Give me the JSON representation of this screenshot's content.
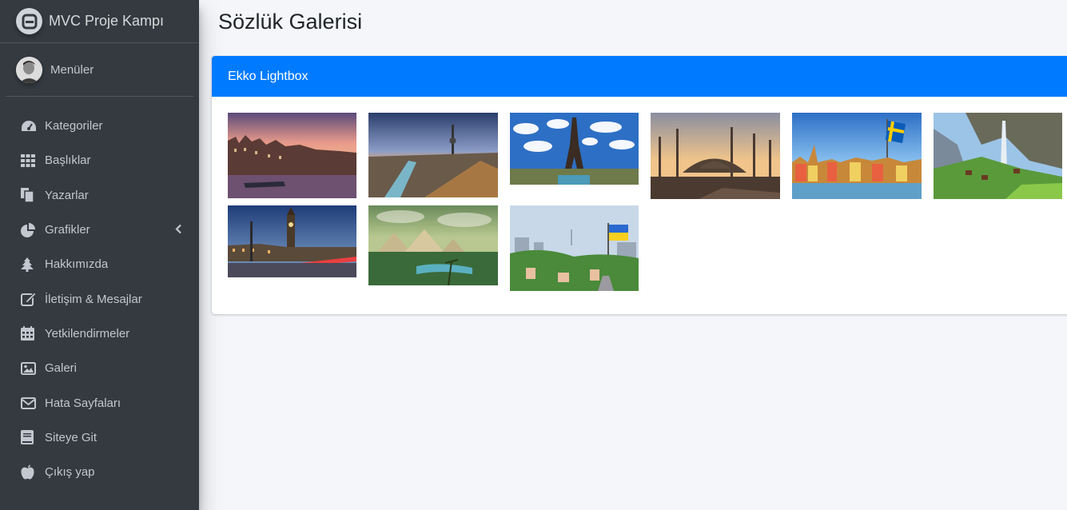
{
  "brand": {
    "title": "MVC Proje Kampı"
  },
  "user": {
    "name": "Menüler"
  },
  "sidebar": {
    "items": [
      {
        "label": "Kategoriler",
        "icon": "tachometer-icon"
      },
      {
        "label": "Başlıklar",
        "icon": "grid-icon"
      },
      {
        "label": "Yazarlar",
        "icon": "copy-icon"
      },
      {
        "label": "Grafikler",
        "icon": "pie-chart-icon",
        "has_submenu": true
      },
      {
        "label": "Hakkımızda",
        "icon": "tree-icon"
      },
      {
        "label": "İletişim & Mesajlar",
        "icon": "edit-icon"
      },
      {
        "label": "Yetkilendirmeler",
        "icon": "calendar-icon"
      },
      {
        "label": "Galeri",
        "icon": "image-icon"
      },
      {
        "label": "Hata Sayfaları",
        "icon": "envelope-icon"
      },
      {
        "label": "Siteye Git",
        "icon": "book-icon"
      },
      {
        "label": "Çıkış yap",
        "icon": "apple-icon"
      }
    ]
  },
  "page": {
    "title": "Sözlük Galerisi"
  },
  "card": {
    "header": "Ekko Lightbox"
  },
  "gallery": {
    "images": [
      {
        "subject": "Amsterdam canal"
      },
      {
        "subject": "Berlin skyline"
      },
      {
        "subject": "Eiffel Tower Paris"
      },
      {
        "subject": "Istanbul Blue Mosque"
      },
      {
        "subject": "Stockholm waterfront with Swedish flag"
      },
      {
        "subject": "Swiss valley waterfall"
      },
      {
        "subject": "London Big Ben"
      },
      {
        "subject": "Egypt pyramids"
      },
      {
        "subject": "Kyiv with Ukrainian flag"
      }
    ]
  },
  "colors": {
    "sidebar_bg": "#343a40",
    "accent": "#007bff",
    "content_bg": "#f4f6f9"
  }
}
